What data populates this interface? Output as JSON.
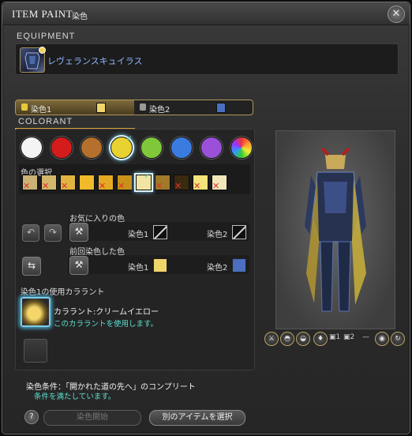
{
  "window": {
    "title_en": "ITEM PAINT",
    "title_jp": "染色",
    "close_icon": "gear-close-icon"
  },
  "equipment": {
    "header": "EQUIPMENT",
    "item_name": "レヴェランスキュイラス"
  },
  "dye_tabs": [
    {
      "label": "染色1",
      "swatch": "#f2d56a",
      "active": true
    },
    {
      "label": "染色2",
      "swatch": "#4a6fc0",
      "active": false
    }
  ],
  "colorant": {
    "header": "COLORANT",
    "categories": [
      {
        "name": "white",
        "color": "#f4f4f4"
      },
      {
        "name": "red",
        "color": "#d41c1c"
      },
      {
        "name": "brown",
        "color": "#b4702c"
      },
      {
        "name": "yellow",
        "color": "#e8d230",
        "selected": true
      },
      {
        "name": "green",
        "color": "#80c83a"
      },
      {
        "name": "blue",
        "color": "#3a7be0"
      },
      {
        "name": "purple",
        "color": "#9a50d8"
      },
      {
        "name": "special",
        "color": "rainbow"
      }
    ],
    "shade_label": "色の選択",
    "shades": [
      {
        "color": "#c9b274",
        "available": false
      },
      {
        "color": "#d2b66a",
        "available": false
      },
      {
        "color": "#e0b440",
        "available": false
      },
      {
        "color": "#f0bb2a",
        "available": true
      },
      {
        "color": "#e4aa22",
        "available": false
      },
      {
        "color": "#c8921a",
        "available": false
      },
      {
        "color": "#f2e4a2",
        "available": true,
        "selected": true
      },
      {
        "color": "#a07a28",
        "available": false
      },
      {
        "color": "#3a2a10",
        "available": false
      },
      {
        "color": "#f4e27a",
        "available": false
      },
      {
        "color": "#f2e6b8",
        "available": false
      }
    ],
    "favorites": {
      "label": "お気に入りの色",
      "dye1_label": "染色1",
      "dye2_label": "染色2"
    },
    "previous": {
      "label": "前回染色した色",
      "dye1_label": "染色1",
      "dye1_color": "#f2d56a",
      "dye2_label": "染色2",
      "dye2_color": "#4a6fc0"
    },
    "usage_label": "染色1の使用カララント",
    "selected_name": "カララント:クリームイエロー",
    "selected_hint": "このカララントを使用します。"
  },
  "condition": {
    "text": "染色条件：「開かれた道の先へ」のコンプリート",
    "status": "条件を満たしています。"
  },
  "buttons": {
    "help": "?",
    "start": "染色開始",
    "select_other": "別のアイテムを選択"
  },
  "preview_icons": [
    "weapon-icon",
    "head-icon",
    "hat-icon",
    "dye-visor-icon",
    "dye1-icon",
    "dye2-icon",
    "minus-icon",
    "eye-icon",
    "rotate-icon"
  ],
  "preview_icon_labels": {
    "dye1": "1",
    "dye2": "2"
  }
}
